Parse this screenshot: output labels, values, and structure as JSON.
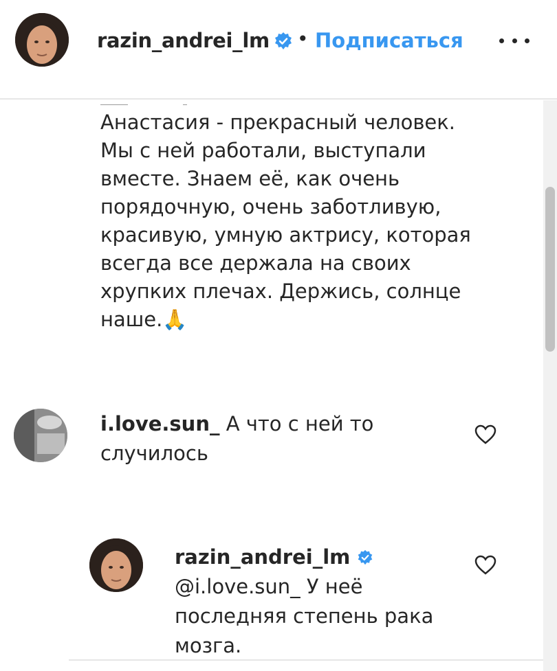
{
  "header": {
    "username": "razin_andrei_lm",
    "separator": "•",
    "follow_label": "Подписаться",
    "more_icon": "more-horizontal-icon"
  },
  "caption": {
    "lines": [
      "Анастасия - прекрасный человек.",
      "Мы с ней работали, выступали",
      "вместе. Знаем её, как очень",
      "порядочную, очень заботливую,",
      "красивую, умную актрису, которая",
      "всегда все держала на своих",
      "хрупких плечах. Держись, солнце",
      "наше.🙏"
    ]
  },
  "comments": [
    {
      "username": "i.love.sun_",
      "text": "А что с ней то случилось",
      "like_icon": "heart-icon"
    },
    {
      "username": "razin_andrei_lm",
      "text": "@i.love.sun_ У неё последняя степень рака мозга.",
      "like_icon": "heart-icon"
    }
  ],
  "colors": {
    "accent": "#3897f0",
    "text": "#262626",
    "verified": "#3897f0"
  }
}
